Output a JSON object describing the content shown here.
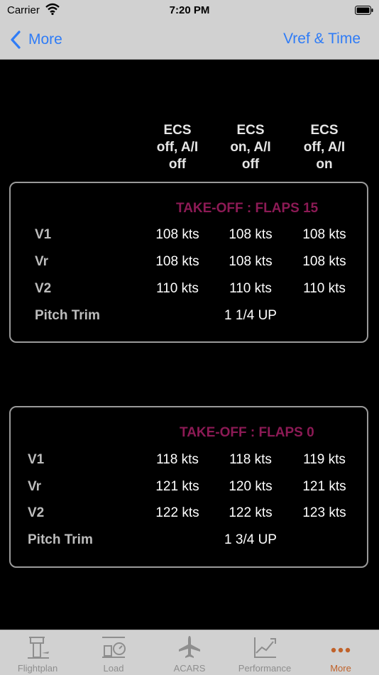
{
  "status_bar": {
    "carrier": "Carrier",
    "time": "7:20 PM"
  },
  "nav": {
    "back_label": "More",
    "right_label": "Vref & Time"
  },
  "columns": [
    [
      "ECS",
      "off, A/I",
      "off"
    ],
    [
      "ECS",
      "on, A/I",
      "off"
    ],
    [
      "ECS",
      "off, A/I",
      "on"
    ]
  ],
  "cards": [
    {
      "title": "TAKE-OFF : FLAPS 15",
      "rows": [
        {
          "label": "V1",
          "values": [
            "108 kts",
            "108 kts",
            "108 kts"
          ]
        },
        {
          "label": "Vr",
          "values": [
            "108 kts",
            "108 kts",
            "108 kts"
          ]
        },
        {
          "label": "V2",
          "values": [
            "110 kts",
            "110 kts",
            "110 kts"
          ]
        }
      ],
      "trim_label": "Pitch Trim",
      "trim_value": "1 1/4 UP"
    },
    {
      "title": "TAKE-OFF : FLAPS 0",
      "rows": [
        {
          "label": "V1",
          "values": [
            "118 kts",
            "118 kts",
            "119 kts"
          ]
        },
        {
          "label": "Vr",
          "values": [
            "121 kts",
            "120 kts",
            "121 kts"
          ]
        },
        {
          "label": "V2",
          "values": [
            "122 kts",
            "122 kts",
            "123 kts"
          ]
        }
      ],
      "trim_label": "Pitch Trim",
      "trim_value": "1 3/4 UP"
    }
  ],
  "tabs": [
    {
      "label": "Flightplan",
      "icon": "control-tower-icon",
      "active": false
    },
    {
      "label": "Load",
      "icon": "luggage-scale-icon",
      "active": false
    },
    {
      "label": "ACARS",
      "icon": "airplane-icon",
      "active": false
    },
    {
      "label": "Performance",
      "icon": "chart-plane-icon",
      "active": false
    },
    {
      "label": "More",
      "icon": "more-dots-icon",
      "active": true
    }
  ],
  "colors": {
    "accent": "#2f7cf6",
    "title": "#8c1a55",
    "tab_active": "#c0622a"
  }
}
